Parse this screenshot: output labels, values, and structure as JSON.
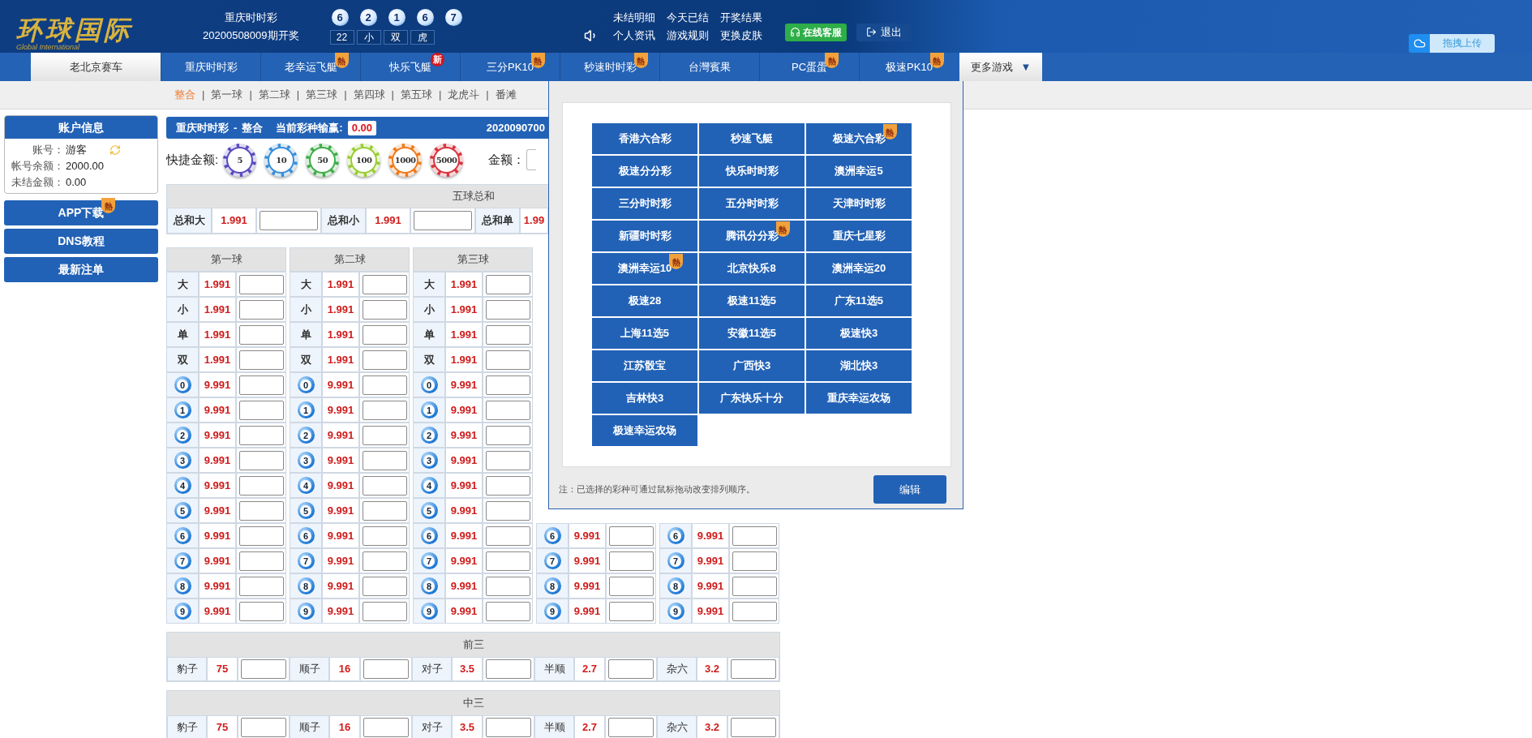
{
  "logo": {
    "name": "环球国际",
    "subtitle": "Global International"
  },
  "draw": {
    "game": "重庆时时彩",
    "period": "20200508009期开奖",
    "balls": [
      "6",
      "2",
      "1",
      "6",
      "7"
    ],
    "results": [
      "22",
      "小",
      "双",
      "虎"
    ]
  },
  "links": [
    "未结明细",
    "今天已结",
    "开奖结果",
    "个人资讯",
    "游戏规则",
    "更换皮肤"
  ],
  "service_button": "在线客服",
  "logout_button": "退出",
  "upload_button": "拖拽上传",
  "tabs": [
    {
      "label": "老北京赛车",
      "selected": true
    },
    {
      "label": "重庆时时彩",
      "selected": false
    },
    {
      "label": "老幸运飞艇",
      "selected": false,
      "badge": {
        "kind": "hot",
        "text": "熱"
      }
    },
    {
      "label": "快乐飞艇",
      "selected": false,
      "badge": {
        "kind": "new",
        "text": "新"
      }
    },
    {
      "label": "三分PK10",
      "selected": false,
      "badge": {
        "kind": "hot",
        "text": "熱"
      }
    },
    {
      "label": "秒速时时彩",
      "selected": false,
      "badge": {
        "kind": "hot",
        "text": "熱"
      }
    },
    {
      "label": "台灣賓果",
      "selected": false
    },
    {
      "label": "PC蛋蛋",
      "selected": false,
      "badge": {
        "kind": "hot",
        "text": "熱"
      }
    },
    {
      "label": "极速PK10",
      "selected": false,
      "badge": {
        "kind": "hot",
        "text": "熱"
      }
    }
  ],
  "more_tab": {
    "label": "更多游戏",
    "caret": "▼",
    "expanded": true
  },
  "subnav": [
    {
      "label": "整合",
      "selected": true
    },
    {
      "label": "第一球",
      "selected": false
    },
    {
      "label": "第二球",
      "selected": false
    },
    {
      "label": "第三球",
      "selected": false
    },
    {
      "label": "第四球",
      "selected": false
    },
    {
      "label": "第五球",
      "selected": false
    },
    {
      "label": "龙虎斗",
      "selected": false
    },
    {
      "label": "番滩",
      "selected": false
    }
  ],
  "subnav_separator": "|",
  "account": {
    "title": "账户信息",
    "fields": [
      {
        "label": "账号：",
        "value": "游客"
      },
      {
        "label": "帐号余额：",
        "value": "2000.00"
      },
      {
        "label": "未结金额：",
        "value": "0.00"
      }
    ]
  },
  "side_buttons": [
    {
      "label": "APP下载",
      "badge": {
        "kind": "hot",
        "text": "熱"
      }
    },
    {
      "label": "DNS教程"
    },
    {
      "label": "最新注单"
    }
  ],
  "panel": {
    "game": "重庆时时彩",
    "separator": "-",
    "play": "整合",
    "profit_label": "当前彩种输赢:",
    "profit": "0.00",
    "period": "2020090700"
  },
  "chips_label": "快捷金额:",
  "chips": [
    {
      "value": "5",
      "color": "#5a4cc0"
    },
    {
      "value": "10",
      "color": "#3a8fd8"
    },
    {
      "value": "50",
      "color": "#3fae49"
    },
    {
      "value": "100",
      "color": "#9acd32"
    },
    {
      "value": "1000",
      "color": "#f07a1a"
    },
    {
      "value": "5000",
      "color": "#d9343f"
    }
  ],
  "amount_label": "金额：",
  "sum_table": {
    "title": "五球总和",
    "cells": [
      {
        "label": "总和大",
        "odds": "1.991",
        "field": true
      },
      {
        "label": "总和小",
        "odds": "1.991",
        "field": true
      },
      {
        "label": "总和单",
        "odds": "1.99",
        "field": false
      }
    ]
  },
  "ball_columns": [
    {
      "title": "第一球",
      "rows": [
        {
          "kind": "text",
          "label": "大",
          "odds": "1.991"
        },
        {
          "kind": "text",
          "label": "小",
          "odds": "1.991"
        },
        {
          "kind": "text",
          "label": "单",
          "odds": "1.991"
        },
        {
          "kind": "text",
          "label": "双",
          "odds": "1.991"
        },
        {
          "kind": "ball",
          "label": "0",
          "odds": "9.991"
        },
        {
          "kind": "ball",
          "label": "1",
          "odds": "9.991"
        },
        {
          "kind": "ball",
          "label": "2",
          "odds": "9.991"
        },
        {
          "kind": "ball",
          "label": "3",
          "odds": "9.991"
        },
        {
          "kind": "ball",
          "label": "4",
          "odds": "9.991"
        },
        {
          "kind": "ball",
          "label": "5",
          "odds": "9.991"
        },
        {
          "kind": "ball",
          "label": "6",
          "odds": "9.991"
        },
        {
          "kind": "ball",
          "label": "7",
          "odds": "9.991"
        },
        {
          "kind": "ball",
          "label": "8",
          "odds": "9.991"
        },
        {
          "kind": "ball",
          "label": "9",
          "odds": "9.991"
        }
      ]
    },
    {
      "title": "第二球",
      "rows": [
        {
          "kind": "text",
          "label": "大",
          "odds": "1.991"
        },
        {
          "kind": "text",
          "label": "小",
          "odds": "1.991"
        },
        {
          "kind": "text",
          "label": "单",
          "odds": "1.991"
        },
        {
          "kind": "text",
          "label": "双",
          "odds": "1.991"
        },
        {
          "kind": "ball",
          "label": "0",
          "odds": "9.991"
        },
        {
          "kind": "ball",
          "label": "1",
          "odds": "9.991"
        },
        {
          "kind": "ball",
          "label": "2",
          "odds": "9.991"
        },
        {
          "kind": "ball",
          "label": "3",
          "odds": "9.991"
        },
        {
          "kind": "ball",
          "label": "4",
          "odds": "9.991"
        },
        {
          "kind": "ball",
          "label": "5",
          "odds": "9.991"
        },
        {
          "kind": "ball",
          "label": "6",
          "odds": "9.991"
        },
        {
          "kind": "ball",
          "label": "7",
          "odds": "9.991"
        },
        {
          "kind": "ball",
          "label": "8",
          "odds": "9.991"
        },
        {
          "kind": "ball",
          "label": "9",
          "odds": "9.991"
        }
      ]
    },
    {
      "title": "第三球",
      "rows": [
        {
          "kind": "text",
          "label": "大",
          "odds": "1.991"
        },
        {
          "kind": "text",
          "label": "小",
          "odds": "1.991"
        },
        {
          "kind": "text",
          "label": "单",
          "odds": "1.991"
        },
        {
          "kind": "text",
          "label": "双",
          "odds": "1.991"
        },
        {
          "kind": "ball",
          "label": "0",
          "odds": "9.991"
        },
        {
          "kind": "ball",
          "label": "1",
          "odds": "9.991"
        },
        {
          "kind": "ball",
          "label": "2",
          "odds": "9.991"
        },
        {
          "kind": "ball",
          "label": "3",
          "odds": "9.991"
        },
        {
          "kind": "ball",
          "label": "4",
          "odds": "9.991"
        },
        {
          "kind": "ball",
          "label": "5",
          "odds": "9.991"
        },
        {
          "kind": "ball",
          "label": "6",
          "odds": "9.991"
        },
        {
          "kind": "ball",
          "label": "7",
          "odds": "9.991"
        },
        {
          "kind": "ball",
          "label": "8",
          "odds": "9.991"
        },
        {
          "kind": "ball",
          "label": "9",
          "odds": "9.991"
        }
      ]
    },
    {
      "rows": [
        {
          "kind": "ball",
          "label": "6",
          "odds": "9.991"
        },
        {
          "kind": "ball",
          "label": "7",
          "odds": "9.991"
        },
        {
          "kind": "ball",
          "label": "8",
          "odds": "9.991"
        },
        {
          "kind": "ball",
          "label": "9",
          "odds": "9.991"
        }
      ]
    },
    {
      "rows": [
        {
          "kind": "ball",
          "label": "6",
          "odds": "9.991"
        },
        {
          "kind": "ball",
          "label": "7",
          "odds": "9.991"
        },
        {
          "kind": "ball",
          "label": "8",
          "odds": "9.991"
        },
        {
          "kind": "ball",
          "label": "9",
          "odds": "9.991"
        }
      ]
    }
  ],
  "groups": [
    {
      "title": "前三",
      "cells": [
        {
          "label": "豹子",
          "odds": "75"
        },
        {
          "label": "顺子",
          "odds": "16"
        },
        {
          "label": "对子",
          "odds": "3.5"
        },
        {
          "label": "半顺",
          "odds": "2.7"
        },
        {
          "label": "杂六",
          "odds": "3.2"
        }
      ]
    },
    {
      "title": "中三",
      "cells": [
        {
          "label": "豹子",
          "odds": "75"
        },
        {
          "label": "顺子",
          "odds": "16"
        },
        {
          "label": "对子",
          "odds": "3.5"
        },
        {
          "label": "半顺",
          "odds": "2.7"
        },
        {
          "label": "杂六",
          "odds": "3.2"
        }
      ]
    }
  ],
  "more_games": {
    "items": [
      {
        "label": "香港六合彩"
      },
      {
        "label": "秒速飞艇"
      },
      {
        "label": "极速六合彩",
        "badge": {
          "kind": "hot",
          "text": "熱"
        }
      },
      {
        "label": "极速分分彩"
      },
      {
        "label": "快乐时时彩"
      },
      {
        "label": "澳洲幸运5"
      },
      {
        "label": "三分时时彩"
      },
      {
        "label": "五分时时彩"
      },
      {
        "label": "天津时时彩"
      },
      {
        "label": "新疆时时彩"
      },
      {
        "label": "腾讯分分彩",
        "badge": {
          "kind": "hot",
          "text": "熱"
        }
      },
      {
        "label": "重庆七星彩"
      },
      {
        "label": "澳洲幸运10",
        "badge": {
          "kind": "hot",
          "text": "熱"
        }
      },
      {
        "label": "北京快乐8"
      },
      {
        "label": "澳洲幸运20"
      },
      {
        "label": "极速28"
      },
      {
        "label": "极速11选5"
      },
      {
        "label": "广东11选5"
      },
      {
        "label": "上海11选5"
      },
      {
        "label": "安徽11选5"
      },
      {
        "label": "极速快3"
      },
      {
        "label": "江苏骰宝"
      },
      {
        "label": "广西快3"
      },
      {
        "label": "湖北快3"
      },
      {
        "label": "吉林快3"
      },
      {
        "label": "广东快乐十分"
      },
      {
        "label": "重庆幸运农场"
      },
      {
        "label": "极速幸运农场"
      }
    ],
    "note": "注：已选择的彩种可通过鼠标拖动改变排列顺序。",
    "edit_button": "编辑"
  }
}
